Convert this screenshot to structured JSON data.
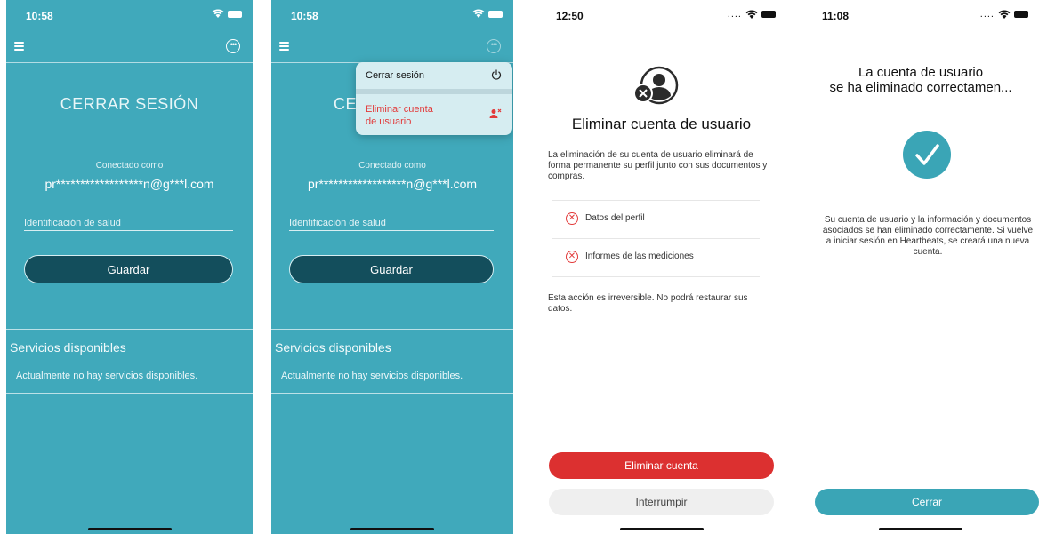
{
  "screen1": {
    "time": "10:58",
    "signal": "....",
    "title": "CERRAR SESIÓN",
    "connected_label": "Conectado como",
    "email": "pr******************n@g***l.com",
    "health_placeholder": "Identificación de salud",
    "save_label": "Guardar",
    "services_title": "Servicios disponibles",
    "services_text": "Actualmente no hay servicios disponibles."
  },
  "screen2": {
    "time": "10:58",
    "title_partial": "CE",
    "connected_label": "Conectado como",
    "email": "pr******************n@g***l.com",
    "health_placeholder": "Identificación de salud",
    "save_label": "Guardar",
    "services_title": "Servicios disponibles",
    "services_text": "Actualmente no hay servicios disponibles.",
    "menu": {
      "logout_label": "Cerrar sesión",
      "delete_label": "Eliminar cuenta de usuario"
    }
  },
  "screen3": {
    "time": "12:50",
    "signal": "....",
    "title": "Eliminar cuenta de usuario",
    "description": "La eliminación de su cuenta de usuario eliminará de forma permanente su perfil junto con sus documentos y compras.",
    "items": [
      {
        "label": "Datos del perfil"
      },
      {
        "label": "Informes de las mediciones"
      }
    ],
    "warning": "Esta acción es irreversible. No podrá restaurar sus datos.",
    "delete_label": "Eliminar cuenta",
    "cancel_label": "Interrumpir"
  },
  "screen4": {
    "time": "11:08",
    "signal": "....",
    "title_line1": "La cuenta de usuario",
    "title_line2": "se ha eliminado correctamen...",
    "message": "Su cuenta de usuario y la información y documentos asociados se han eliminado correctamente. Si vuelve a iniciar sesión en Heartbeats, se creará una nueva cuenta.",
    "close_label": "Cerrar"
  },
  "colors": {
    "teal": "#40a9bb",
    "dark_button": "#134e5c",
    "danger": "#dc3030",
    "accent": "#3aa5b6"
  }
}
